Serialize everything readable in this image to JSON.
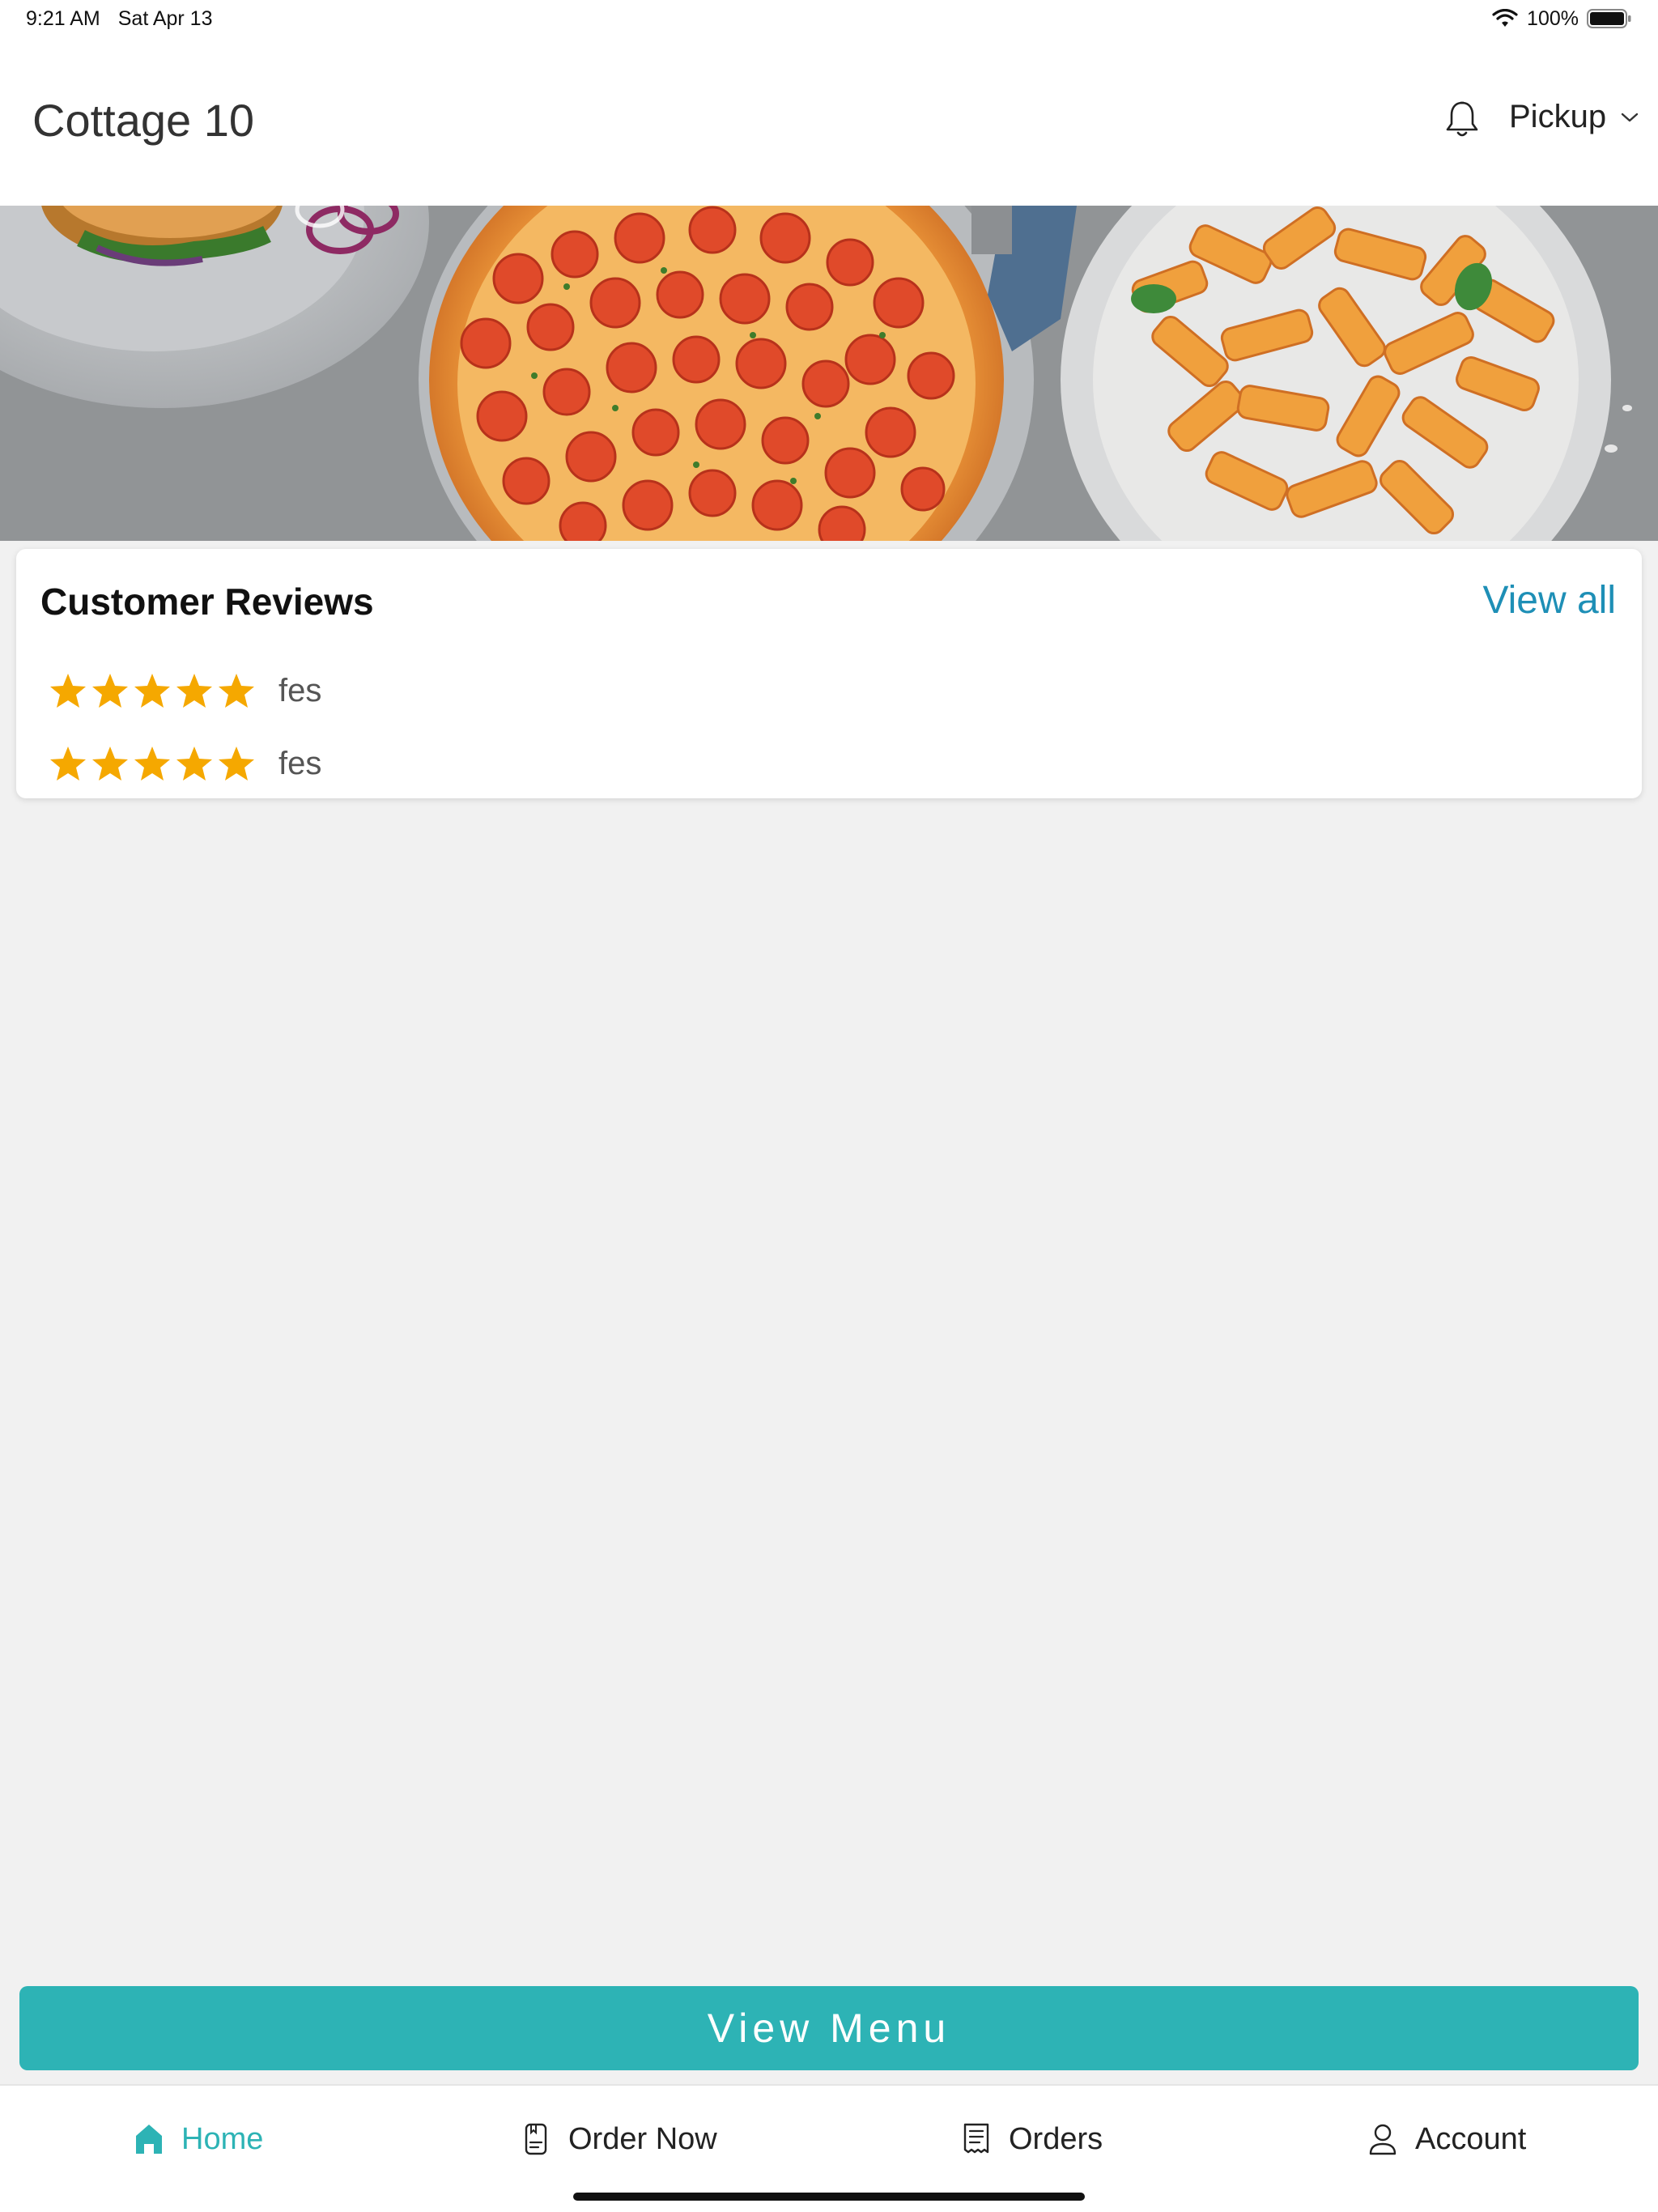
{
  "status_bar": {
    "time": "9:21 AM",
    "date": "Sat Apr 13",
    "battery": "100%"
  },
  "header": {
    "title": "Cottage 10",
    "order_mode": "Pickup"
  },
  "reviews": {
    "title": "Customer Reviews",
    "view_all": "View all",
    "items": [
      {
        "rating": 5,
        "text": "fes"
      },
      {
        "rating": 5,
        "text": "fes"
      }
    ]
  },
  "view_menu_label": "View Menu",
  "nav": {
    "items": [
      {
        "label": "Home",
        "icon": "home-icon",
        "active": true
      },
      {
        "label": "Order Now",
        "icon": "order-icon",
        "active": false
      },
      {
        "label": "Orders",
        "icon": "receipt-icon",
        "active": false
      },
      {
        "label": "Account",
        "icon": "person-icon",
        "active": false
      }
    ]
  },
  "colors": {
    "accent": "#2db3b5",
    "link": "#1e8fb6",
    "star": "#f5a800",
    "background": "#f1f1f1"
  }
}
